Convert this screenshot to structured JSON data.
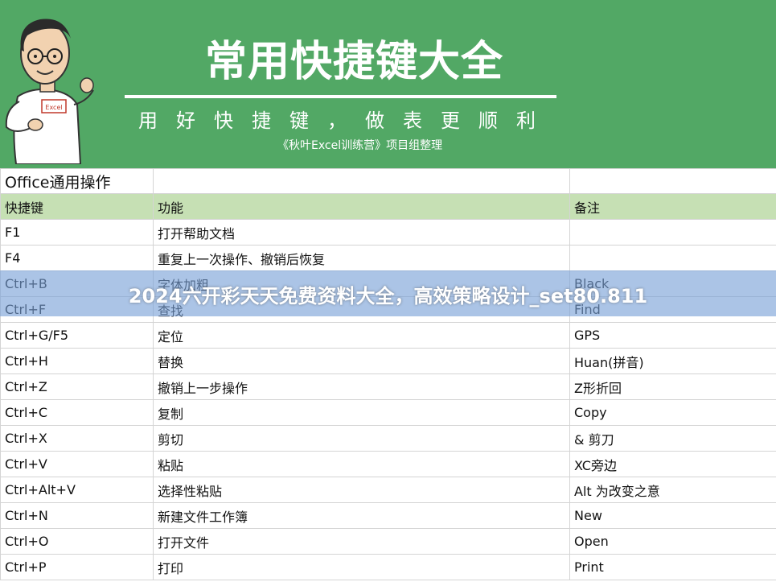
{
  "banner": {
    "title": "常用快捷键大全",
    "subtitle": "用好快捷键，做表更顺利",
    "credit": "《秋叶Excel训练营》项目组整理",
    "shirt_text": "Excel",
    "background": "#52a865"
  },
  "sheet": {
    "section_title": "Office通用操作",
    "headers": [
      "快捷键",
      "功能",
      "备注"
    ],
    "header_color": "#c6e0b4",
    "rows": [
      [
        "F1",
        "打开帮助文档",
        ""
      ],
      [
        "F4",
        "重复上一次操作、撤销后恢复",
        ""
      ],
      [
        "Ctrl+B",
        "字体加粗",
        "Black"
      ],
      [
        "Ctrl+F",
        "查找",
        "Find"
      ],
      [
        "Ctrl+G/F5",
        "定位",
        "GPS"
      ],
      [
        "Ctrl+H",
        "替换",
        "Huan(拼音)"
      ],
      [
        "Ctrl+Z",
        "撤销上一步操作",
        "Z形折回"
      ],
      [
        "Ctrl+C",
        "复制",
        "Copy"
      ],
      [
        "Ctrl+X",
        "剪切",
        "& 剪刀"
      ],
      [
        "Ctrl+V",
        "粘贴",
        "XC旁边"
      ],
      [
        "Ctrl+Alt+V",
        "选择性粘贴",
        "Alt 为改变之意"
      ],
      [
        "Ctrl+N",
        "新建文件工作簿",
        "New"
      ],
      [
        "Ctrl+O",
        "打开文件",
        "Open"
      ],
      [
        "Ctrl+P",
        "打印",
        "Print"
      ]
    ]
  },
  "watermark": {
    "text": "2024六开彩天天免费资料大全，高效策略设计_set80.811"
  }
}
